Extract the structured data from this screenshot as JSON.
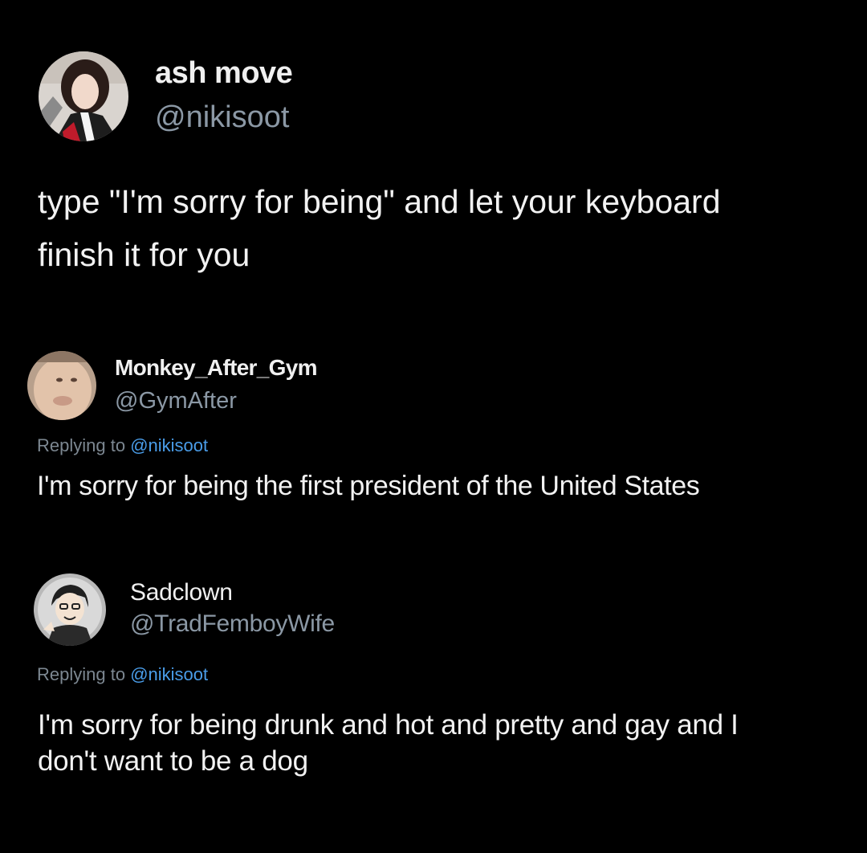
{
  "posts": [
    {
      "display_name": "ash move",
      "handle": "@nikisoot",
      "text_lines": [
        "type \"I'm sorry for being\" and let your keyboard",
        "finish it for you"
      ],
      "avatar_icon": "profile-photo-icon"
    }
  ],
  "replies": [
    {
      "display_name": "Monkey_After_Gym",
      "handle": "@GymAfter",
      "replying_prefix": "Replying to",
      "replying_to": "@nikisoot",
      "text_lines": [
        "I'm sorry for being the first president of the United States"
      ],
      "avatar_icon": "profile-photo-icon"
    },
    {
      "display_name": "Sadclown",
      "handle": "@TradFemboyWife",
      "replying_prefix": "Replying to",
      "replying_to": "@nikisoot",
      "text_lines": [
        "I'm sorry for being drunk and hot and pretty and gay and I",
        "don't want to be a dog"
      ],
      "avatar_icon": "cartoon-avatar-icon"
    }
  ],
  "colors": {
    "background": "#000000",
    "text": "#f2f2f2",
    "muted": "#8b98a5",
    "mention": "#4a9de9"
  }
}
